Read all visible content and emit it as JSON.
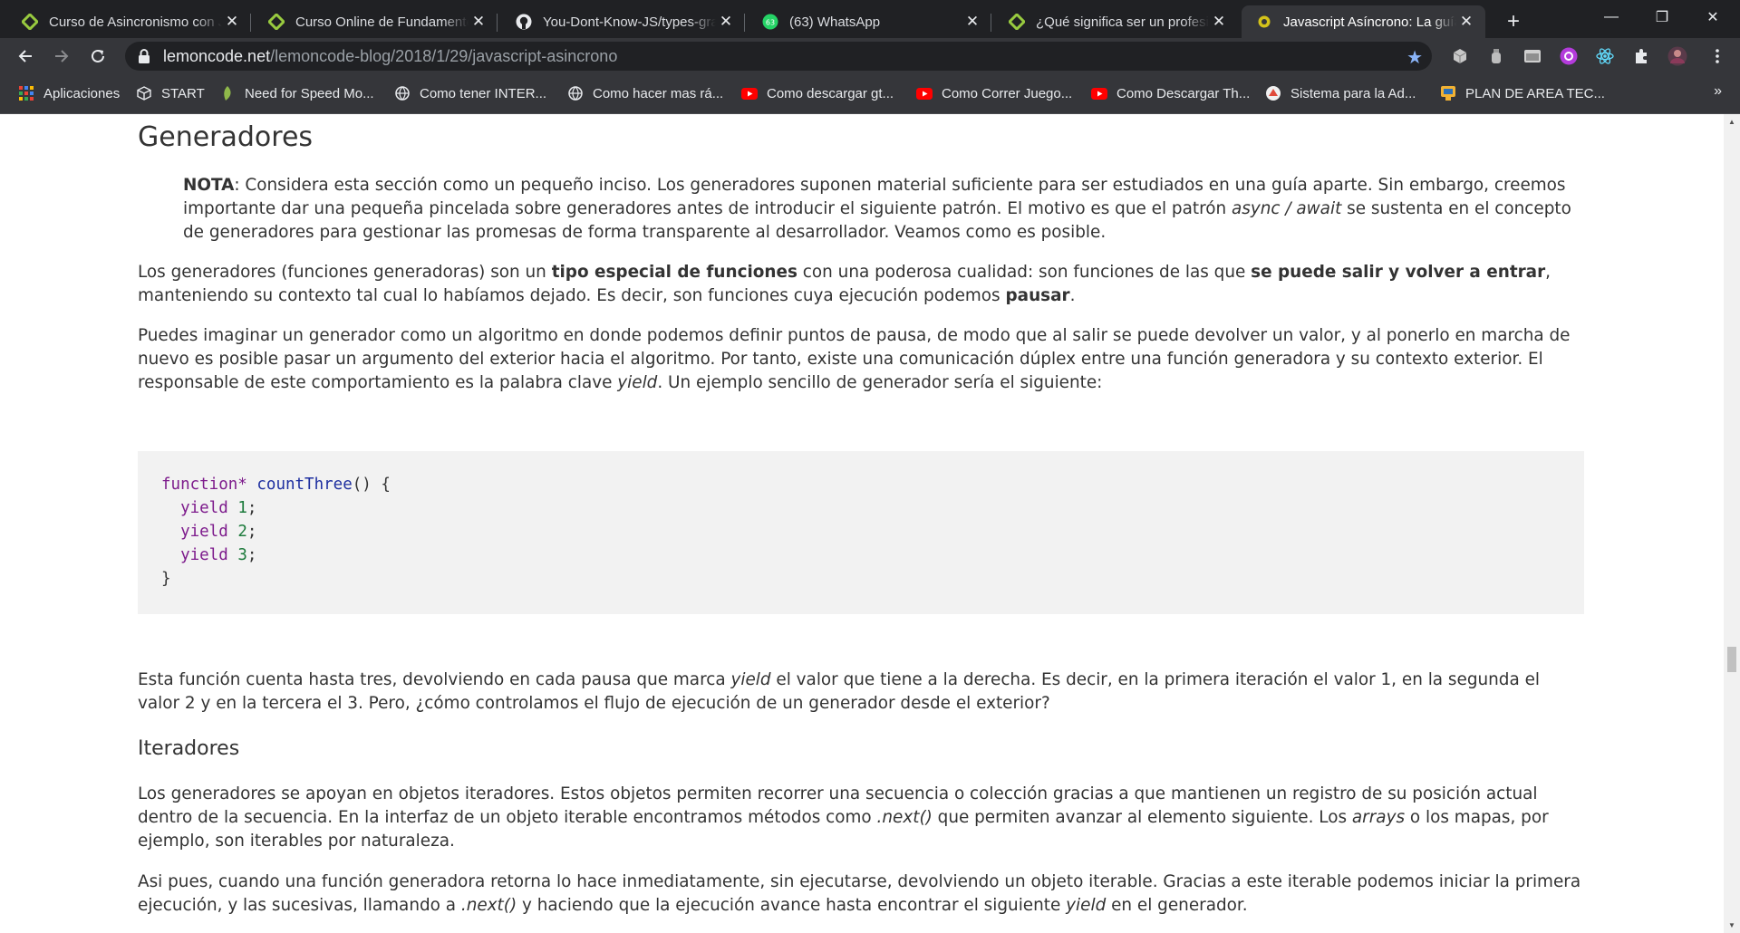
{
  "tabs": [
    {
      "title": "Curso de Asincronismo con JavaScript",
      "favicon": "platzi-icon",
      "active": false
    },
    {
      "title": "Curso Online de Fundamentos de JavaScript",
      "favicon": "platzi-icon",
      "active": false
    },
    {
      "title": "You-Dont-Know-JS/types-grammar",
      "favicon": "github-icon",
      "active": false
    },
    {
      "title": "(63) WhatsApp",
      "favicon": "whatsapp-icon",
      "active": false,
      "badge": "63"
    },
    {
      "title": "¿Qué significa ser un profesional?",
      "favicon": "platzi-icon",
      "active": false
    },
    {
      "title": "Javascript Asíncrono: La guía definitiva",
      "favicon": "lemoncode-icon",
      "active": true
    }
  ],
  "window_controls": {
    "minimize": "—",
    "restore": "❐",
    "close": "✕"
  },
  "address_bar": {
    "host": "lemoncode.net",
    "path": "/lemoncode-blog/2018/1/29/javascript-asincrono"
  },
  "bookmarks": [
    {
      "label": "Aplicaciones",
      "icon": "apps-grid-icon"
    },
    {
      "label": "START",
      "icon": "cube-icon"
    },
    {
      "label": "Need for Speed Mo...",
      "icon": "nfs-icon"
    },
    {
      "label": "Como tener INTER...",
      "icon": "globe-icon"
    },
    {
      "label": "Como hacer mas rá...",
      "icon": "globe-icon"
    },
    {
      "label": "Como descargar gt...",
      "icon": "youtube-icon"
    },
    {
      "label": "Como Correr Juego...",
      "icon": "youtube-icon"
    },
    {
      "label": "Como Descargar Th...",
      "icon": "youtube-icon"
    },
    {
      "label": "Sistema para la Ad...",
      "icon": "system-icon"
    },
    {
      "label": "PLAN DE AREA TEC...",
      "icon": "plan-icon"
    }
  ],
  "article": {
    "heading_generadores": "Generadores",
    "note": {
      "label": "NOTA",
      "t1": ": Considera esta sección como un pequeño inciso. Los generadores suponen material suficiente para ser estudiados en una guía aparte. Sin embargo, creemos importante dar una pequeña pincelada sobre generadores antes de introducir el siguiente patrón. El motivo es que el patrón ",
      "em": "async / await",
      "t2": " se sustenta en el concepto de generadores para gestionar las promesas de forma transparente al desarrollador. Veamos como es posible."
    },
    "p1": {
      "t1": "Los generadores (funciones generadoras) son un ",
      "b1": "tipo especial de funciones",
      "t2": " con una poderosa cualidad: son funciones de las que ",
      "b2": "se puede salir y volver a entrar",
      "t3": ", manteniendo su contexto tal cual lo habíamos dejado. Es decir, son funciones cuya ejecución podemos ",
      "b3": "pausar",
      "t4": "."
    },
    "p2": {
      "t1": "Puedes imaginar un generador como un algoritmo en donde podemos definir puntos de pausa, de modo que al salir se puede devolver un valor, y al ponerlo en marcha de nuevo es posible pasar un argumento del exterior hacia el algoritmo. Por tanto, existe una comunicación dúplex entre una función generadora y su contexto exterior. El responsable de este comportamiento es la palabra clave ",
      "em": "yield",
      "t2": ". Un ejemplo sencillo de generador sería el siguiente:"
    },
    "code": {
      "kw_function": "function*",
      "fn_name": "countThree",
      "sig_rest": "() {",
      "kw_yield": "yield",
      "n1": "1",
      "n2": "2",
      "n3": "3",
      "semi": ";",
      "close": "}"
    },
    "p3": {
      "t1": "Esta función cuenta hasta tres, devolviendo en cada pausa que marca ",
      "em": "yield",
      "t2": " el valor que tiene a la derecha. Es decir, en la primera iteración el valor 1, en la segunda el valor 2 y en la tercera el 3. Pero, ¿cómo controlamos el flujo de ejecución de un generador desde el exterior?"
    },
    "heading_iteradores": "Iteradores",
    "p4": {
      "t1": "Los generadores se apoyan en objetos iteradores. Estos objetos permiten recorrer una secuencia o colección gracias a que mantienen un registro de su posición actual dentro de la secuencia. En la interfaz de un objeto iterable encontramos métodos como ",
      "em1": ".next()",
      "t2": " que permiten avanzar al elemento siguiente. Los ",
      "em2": "arrays",
      "t3": " o los mapas, por ejemplo, son iterables por naturaleza."
    },
    "p5": {
      "t1": "Asi pues, cuando una función generadora retorna lo hace inmediatamente, sin ejecutarse, devolviendo un objeto iterable. Gracias a este iterable podemos iniciar la primera ejecución, y las sucesivas, llamando a ",
      "em1": ".next()",
      "t2": " y haciendo que la ejecución avance hasta encontrar el siguiente ",
      "em2": "yield",
      "t3": " en el generador."
    }
  }
}
